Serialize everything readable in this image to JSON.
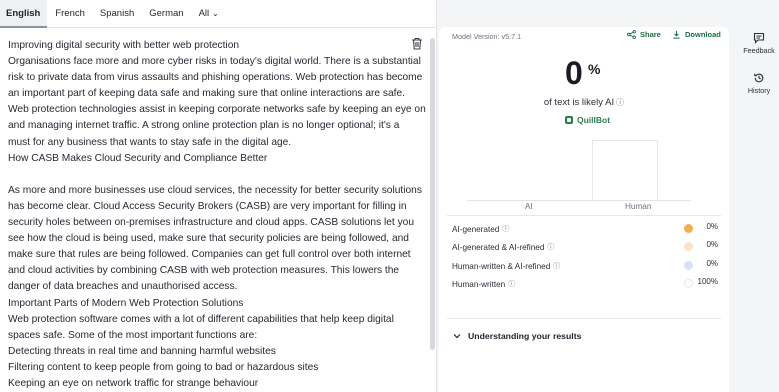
{
  "tabs": [
    {
      "label": "English",
      "active": true
    },
    {
      "label": "French",
      "active": false
    },
    {
      "label": "Spanish",
      "active": false
    },
    {
      "label": "German",
      "active": false
    },
    {
      "label": "All",
      "active": false,
      "dropdown": true
    }
  ],
  "editor": {
    "lines": [
      "Improving digital security with better web protection",
      "Organisations face more and more cyber risks in today's digital world. There is a substantial",
      "risk to private data from virus assaults and phishing operations. Web protection has become",
      "an important part of keeping data safe and making sure that online interactions are safe.",
      "Web protection technologies assist in keeping corporate networks safe by keeping an eye on",
      "and managing internet traffic. A strong online protection plan is no longer optional; it's a",
      "must for any business that wants to stay safe in the digital age.",
      "How CASB Makes Cloud Security and Compliance Better",
      "",
      "As more and more businesses use cloud services, the necessity for better security solutions",
      "has become clear. Cloud Access Security Brokers (CASB) are very important for filling in",
      "security holes between on-premises infrastructure and cloud apps. CASB solutions let you",
      "see how the cloud is being used, make sure that security policies are being followed, and",
      "make sure that rules are being followed. Companies can get full control over both internet",
      "and cloud activities by combining CASB with web protection measures. This lowers the",
      "danger of data breaches and unauthorised access.",
      "Important Parts of Modern Web Protection Solutions",
      "Web protection software comes with a lot of different capabilities that help keep digital",
      "spaces safe. Some of the most important functions are:",
      "Detecting threats in real time and banning harmful websites",
      "Filtering content to keep people from going to bad or hazardous sites",
      "Keeping an eye on network traffic for strange behaviour"
    ],
    "delete_icon": "trash-icon"
  },
  "results": {
    "model_version": "Model Version: v5.7.1",
    "share_label": "Share",
    "download_label": "Download",
    "ai_percent": "0",
    "percent_sign": "%",
    "caption": "of text is likely AI",
    "brand": "QuillBot",
    "axis": {
      "ai": "AI",
      "human": "Human"
    },
    "chart_values": {
      "ai": 0,
      "human": 100
    },
    "breakdown": [
      {
        "label": "AI-generated",
        "value": "0%",
        "color": "#f0b04f"
      },
      {
        "label": "AI-generated & AI-refined",
        "value": "0%",
        "color": "#fbe3c6"
      },
      {
        "label": "Human-written & AI-refined",
        "value": "0%",
        "color": "#d5e3f6"
      },
      {
        "label": "Human-written",
        "value": "100%",
        "color": "#ffffff"
      }
    ],
    "understanding": "Understanding your results"
  },
  "rail": {
    "feedback": "Feedback",
    "history": "History"
  }
}
